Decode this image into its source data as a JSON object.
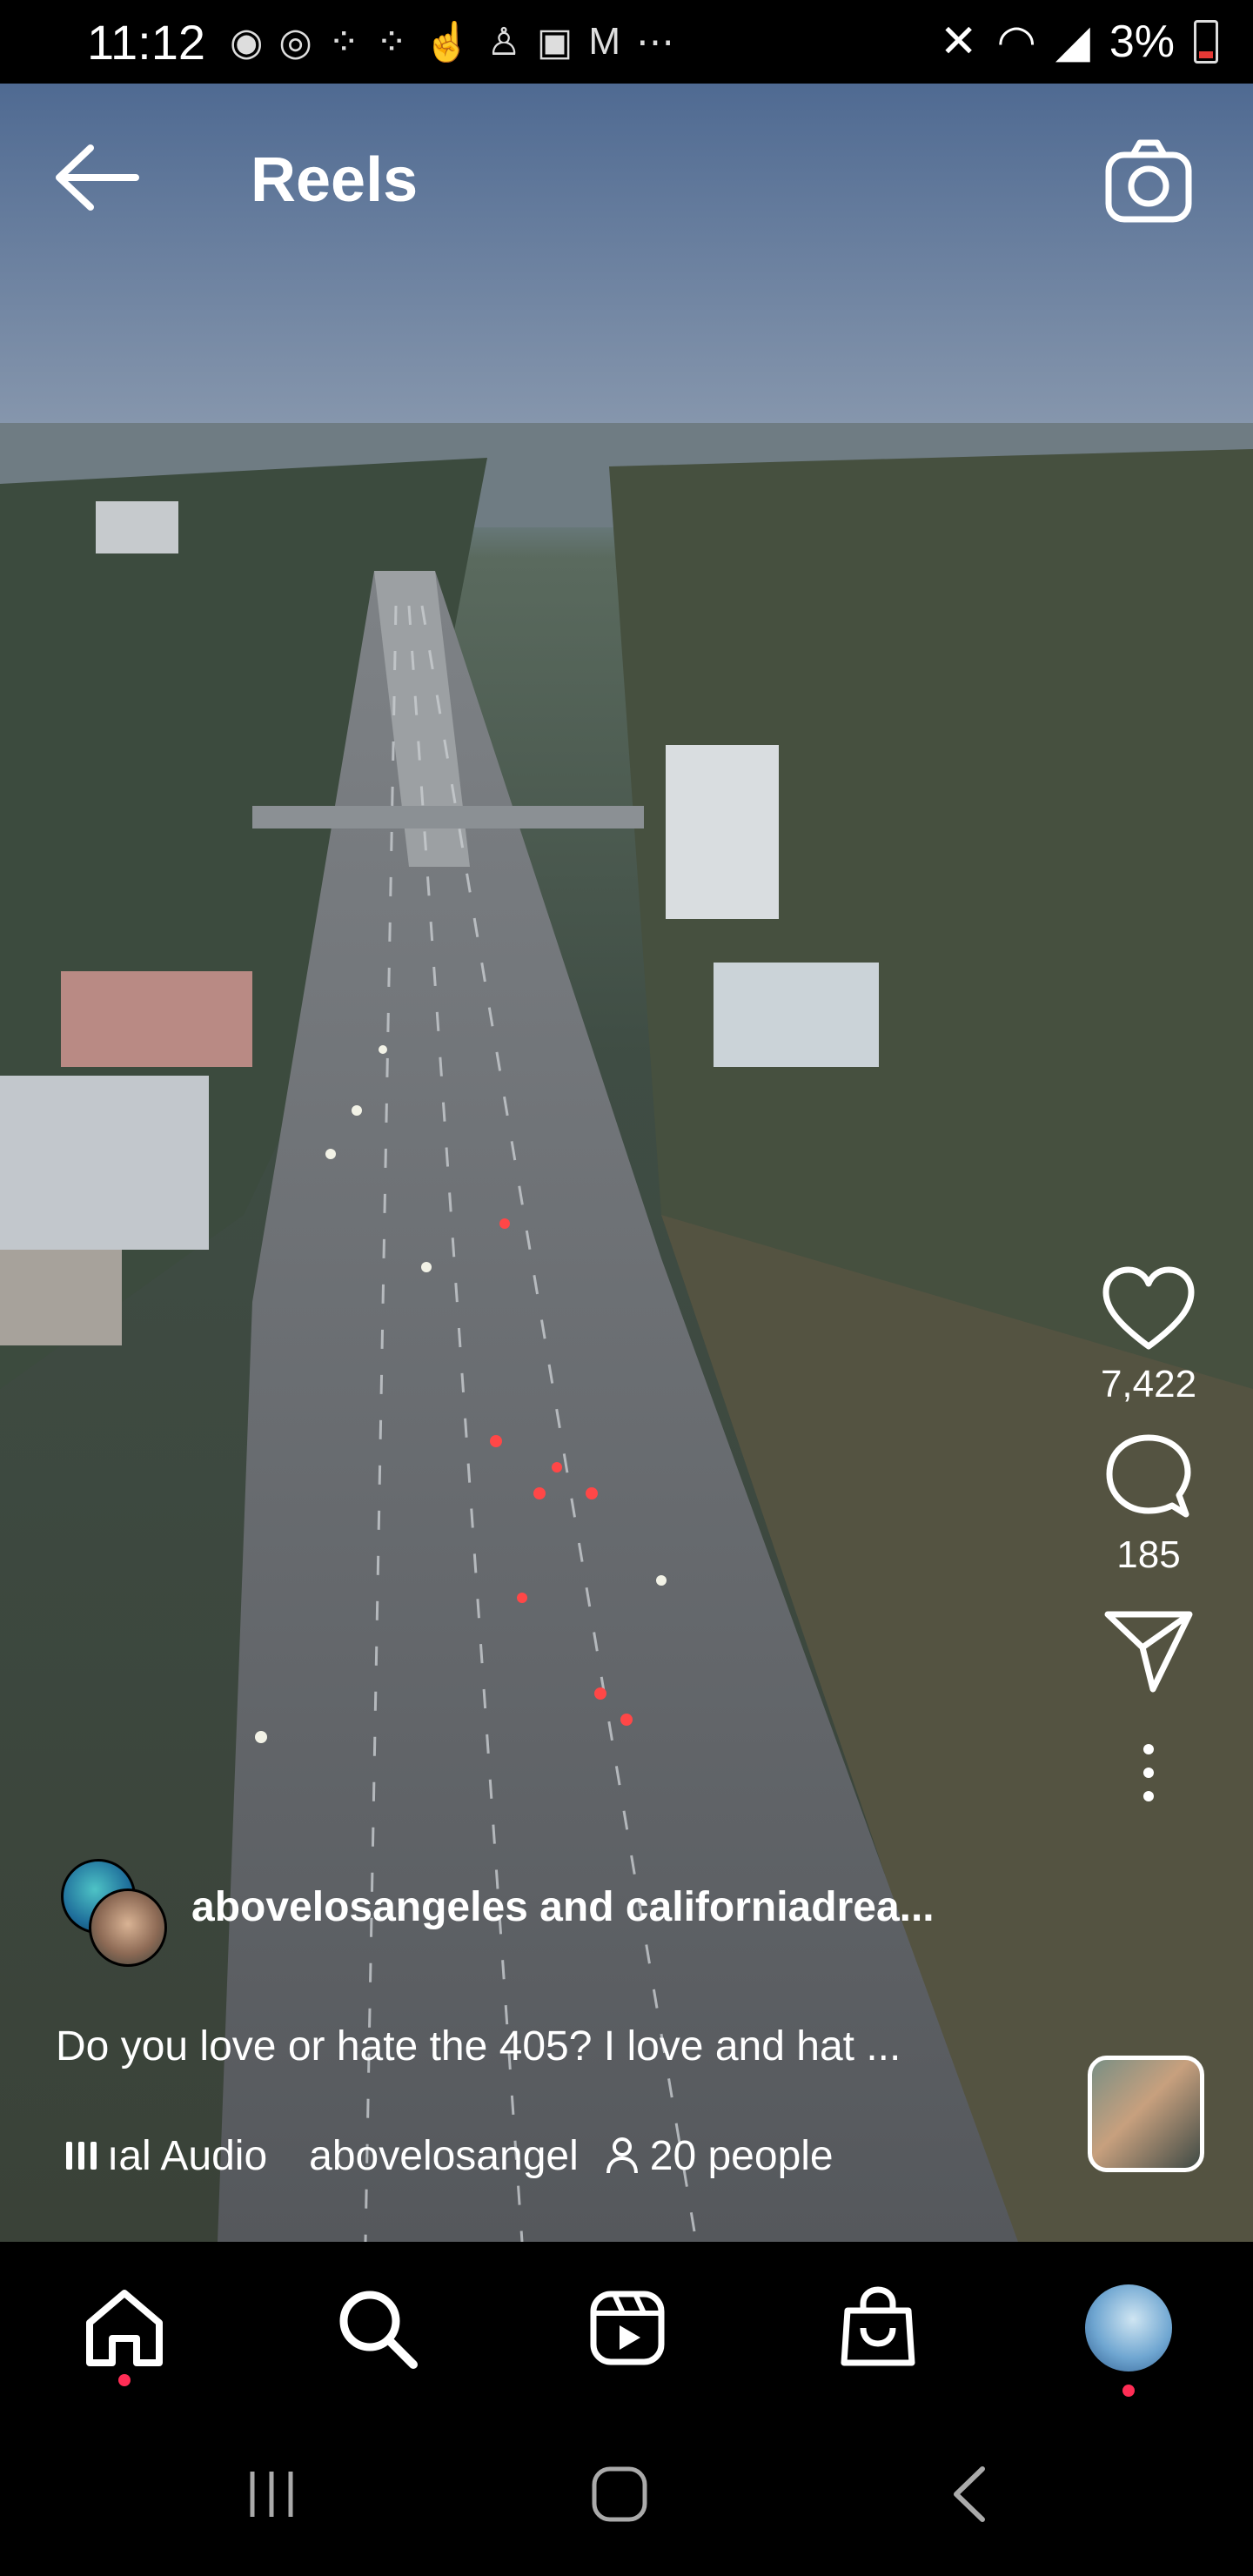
{
  "status_bar": {
    "time": "11:12",
    "battery": "3%"
  },
  "header": {
    "title": "Reels"
  },
  "actions": {
    "likes": "7,422",
    "comments": "185"
  },
  "post": {
    "authors": "abovelosangeles and californiadrea...",
    "caption": "Do you love or hate the 405?  I love and hat ...",
    "audio": "ıal Audio",
    "audio_author": "abovelosangel",
    "people": "20 people"
  },
  "colors": {
    "notification_dot": "#ff2d55",
    "nav_background": "#000000"
  },
  "icons": {
    "back": "back-arrow-icon",
    "camera": "camera-icon",
    "like": "heart-icon",
    "comment": "comment-icon",
    "share": "paper-plane-icon",
    "more": "more-vertical-icon",
    "home": "home-icon",
    "search": "search-icon",
    "reels": "reels-icon",
    "shop": "shopping-bag-icon"
  }
}
